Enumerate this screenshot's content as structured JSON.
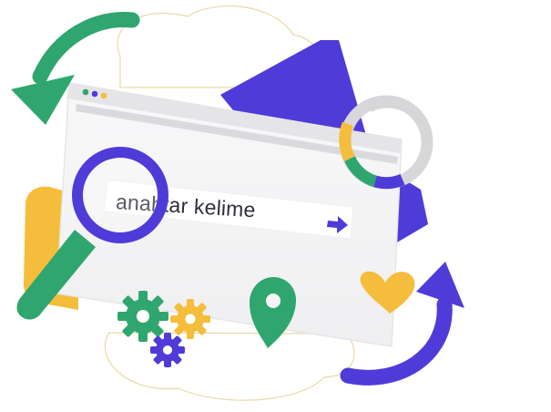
{
  "search": {
    "text": "anahtar kelime"
  },
  "colors": {
    "green": "#2fa66f",
    "purple": "#4f3bd8",
    "yellow": "#f5bd3c",
    "gray": "#d4d4d7",
    "window": "#f3f3f4",
    "line": "#e9d9a5"
  },
  "icons": [
    "refresh-arrow-icon",
    "magnifier-icon",
    "gear-icon",
    "location-pin-icon",
    "heart-icon",
    "donut-chart-icon"
  ]
}
